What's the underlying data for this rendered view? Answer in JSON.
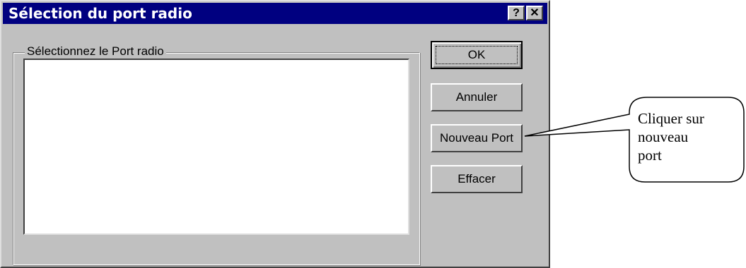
{
  "window": {
    "title": "Sélection du port radio",
    "help_label": "?",
    "close_label": "✕"
  },
  "group": {
    "label": "Sélectionnez le Port radio",
    "items": []
  },
  "buttons": {
    "ok": "OK",
    "cancel": "Annuler",
    "new_port": "Nouveau Port",
    "delete": "Effacer"
  },
  "annotation": {
    "line1": "Cliquer sur",
    "line2": "nouveau",
    "line3": "port"
  },
  "icons": {
    "help": "help-icon",
    "close": "close-icon"
  }
}
